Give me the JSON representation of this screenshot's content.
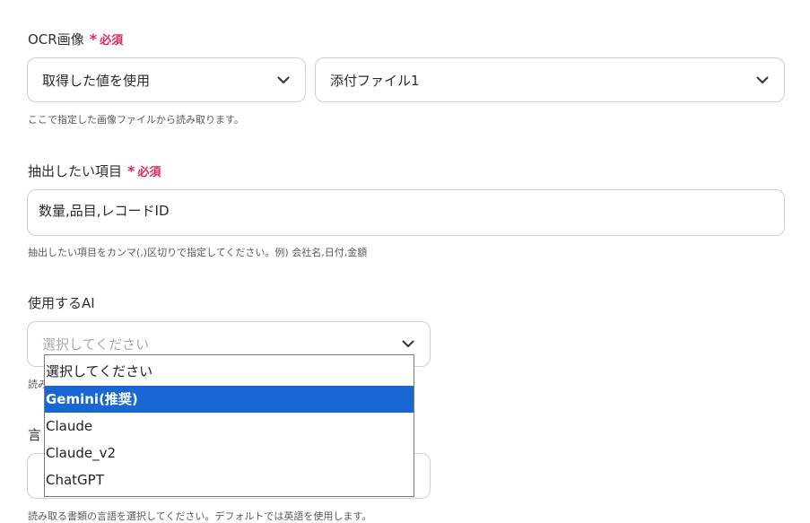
{
  "ocr_image": {
    "label": "OCR画像",
    "required": "必須",
    "source_select": "取得した値を使用",
    "file_select": "添付ファイル1",
    "hint": "ここで指定した画像ファイルから読み取ります。"
  },
  "extract_items": {
    "label": "抽出したい項目",
    "required": "必須",
    "value": "数量,品目,レコードID",
    "hint": "抽出したい項目をカンマ(,)区切りで指定してください。例) 会社名,日付,金額"
  },
  "ai": {
    "label": "使用するAI",
    "placeholder": "選択してください",
    "hint_partial": "読み",
    "options": [
      "選択してください",
      "Gemini(推奨)",
      "Claude",
      "Claude_v2",
      "ChatGPT"
    ],
    "highlighted_index": 1
  },
  "language": {
    "label_partial": "言",
    "hint": "読み取る書類の言語を選択してください。デフォルトでは英語を使用します。"
  },
  "colors": {
    "required": "#e0245e",
    "highlight": "#1967d2"
  },
  "icons": {
    "select_arrow": "chevron-down-icon"
  }
}
